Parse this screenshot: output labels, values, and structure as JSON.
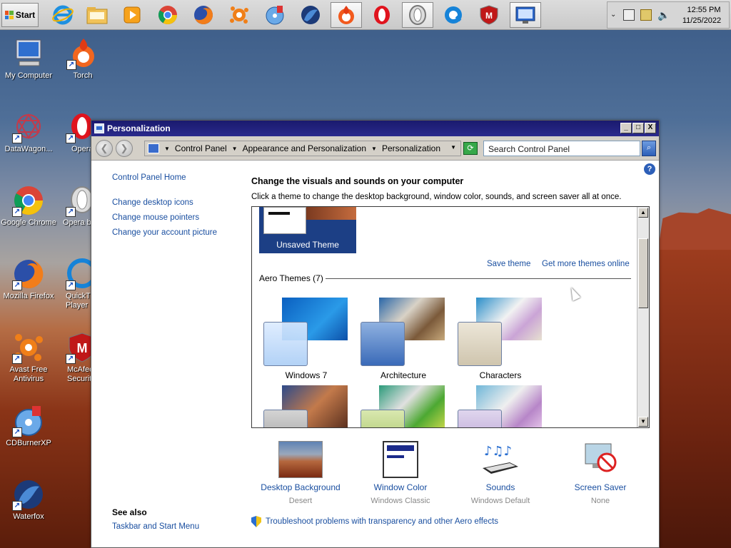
{
  "taskbar": {
    "start_label": "Start",
    "apps": [
      "internet-explorer-icon",
      "file-explorer-icon",
      "media-player-icon",
      "chrome-icon",
      "firefox-icon",
      "avast-icon",
      "cdburnerxp-icon",
      "waterfox-icon",
      "torch-icon",
      "opera-icon",
      "opera-outline-icon",
      "quicktime-icon",
      "mcafee-icon",
      "control-panel-icon"
    ],
    "tray": {
      "time": "12:55 PM",
      "date": "11/25/2022"
    }
  },
  "desktop": {
    "icons": [
      {
        "label": "My Computer"
      },
      {
        "label": "Torch"
      },
      {
        "label": "DataWagon..."
      },
      {
        "label": "Opera"
      },
      {
        "label": "Google Chrome"
      },
      {
        "label": "Opera b"
      },
      {
        "label": "Mozilla Firefox"
      },
      {
        "label": "QuickTime Player"
      },
      {
        "label": "Avast Free Antivirus"
      },
      {
        "label": "McAfee Security"
      },
      {
        "label": "CDBurnerXP"
      },
      {
        "label": "Waterfox"
      }
    ]
  },
  "window": {
    "title": "Personalization",
    "buttons": {
      "minimize": "_",
      "maximize": "□",
      "close": "X"
    },
    "breadcrumb": [
      "Control Panel",
      "Appearance and Personalization",
      "Personalization"
    ],
    "search_placeholder": "Search Control Panel",
    "left_links": [
      "Control Panel Home",
      "Change desktop icons",
      "Change mouse pointers",
      "Change your account picture"
    ],
    "see_also_title": "See also",
    "see_also_links": [
      "Taskbar and Start Menu"
    ],
    "heading": "Change the visuals and sounds on your computer",
    "subheading": "Click a theme to change the desktop background, window color, sounds, and screen saver all at once.",
    "unsaved_theme": "Unsaved Theme",
    "save_theme": "Save theme",
    "get_more": "Get more themes online",
    "aero_group": "Aero Themes (7)",
    "themes": [
      "Windows 7",
      "Architecture",
      "Characters"
    ],
    "bottom": [
      {
        "label": "Desktop Background",
        "sub": "Desert"
      },
      {
        "label": "Window Color",
        "sub": "Windows Classic"
      },
      {
        "label": "Sounds",
        "sub": "Windows Default"
      },
      {
        "label": "Screen Saver",
        "sub": "None"
      }
    ],
    "troubleshoot": "Troubleshoot problems with transparency and other Aero effects"
  }
}
